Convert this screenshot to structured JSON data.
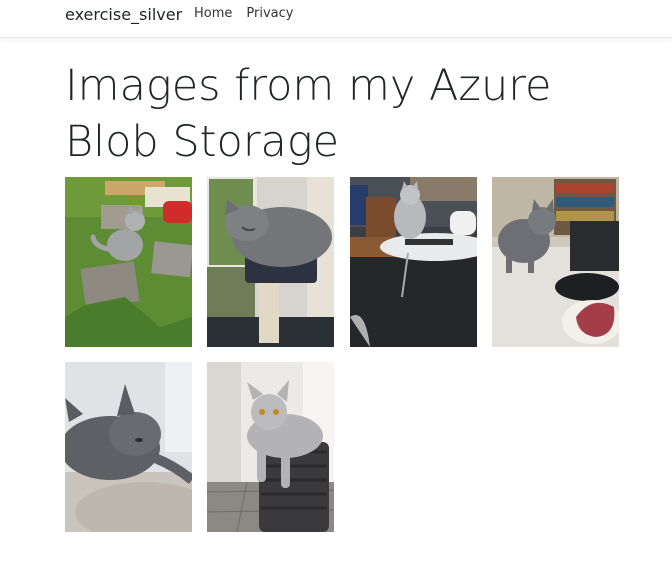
{
  "header": {
    "brand": "exercise_silver",
    "nav": [
      {
        "label": "Home"
      },
      {
        "label": "Privacy"
      }
    ]
  },
  "main": {
    "title": "Images from my Azure Blob Storage"
  },
  "gallery": {
    "images": [
      {
        "name": "cat-photo-1"
      },
      {
        "name": "cat-photo-2"
      },
      {
        "name": "cat-photo-3"
      },
      {
        "name": "cat-photo-4"
      },
      {
        "name": "cat-photo-5"
      },
      {
        "name": "cat-photo-6"
      }
    ]
  },
  "colors": {
    "text": "#212529",
    "border": "#e5e5e5"
  }
}
